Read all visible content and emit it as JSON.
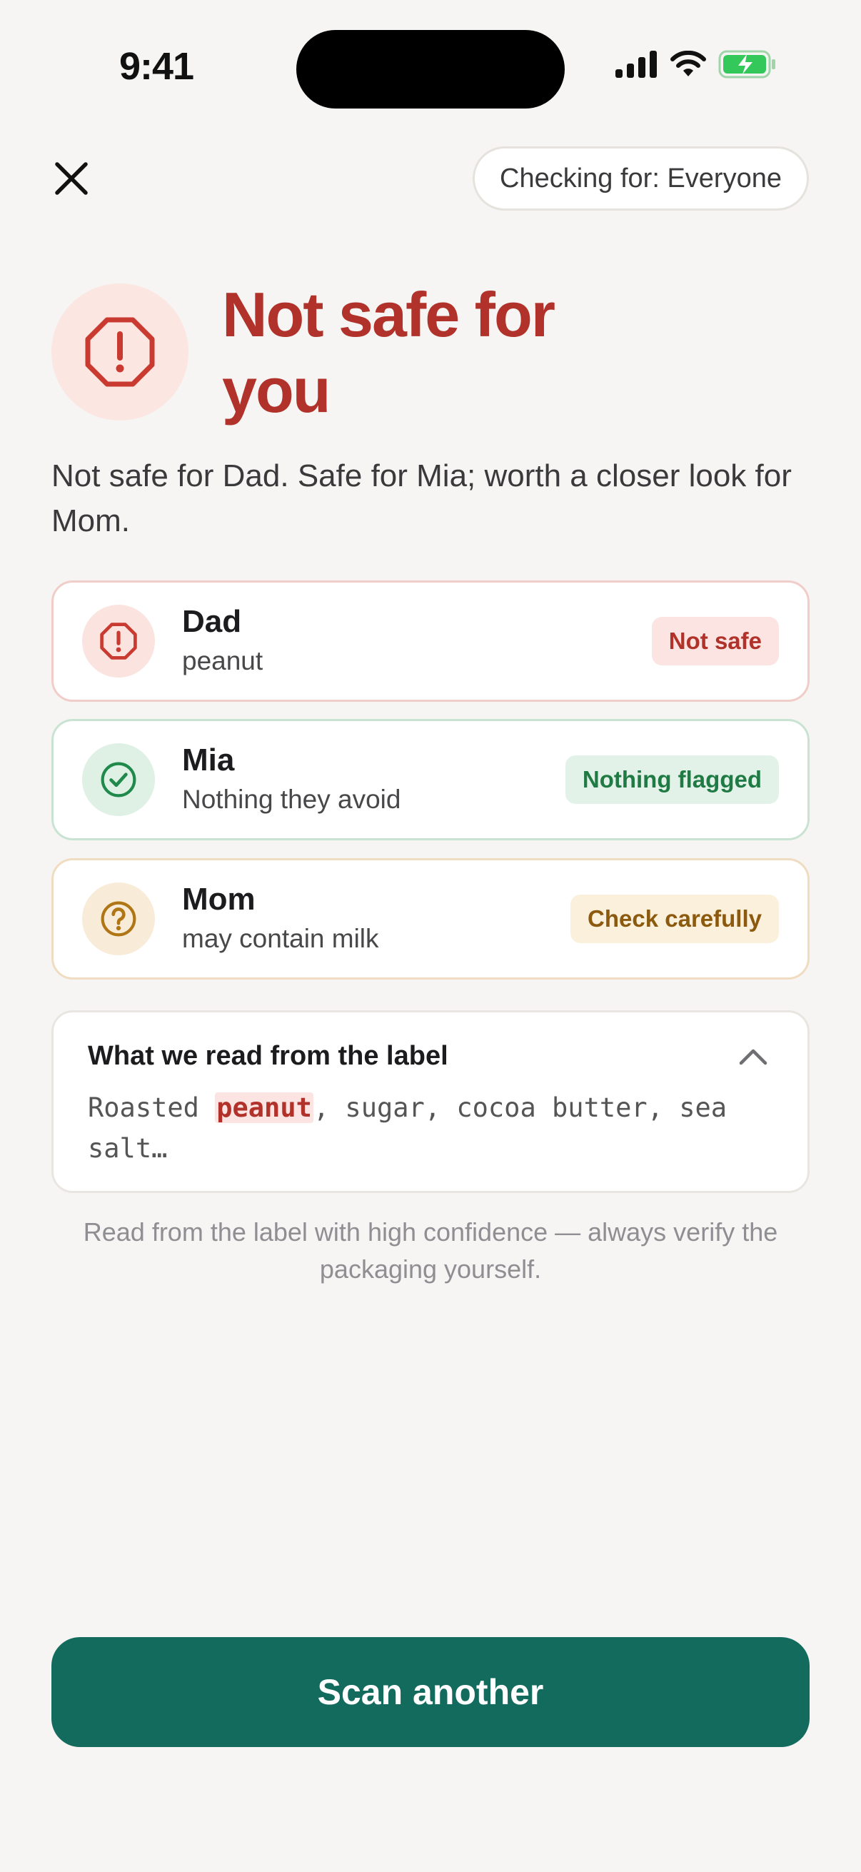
{
  "status_bar": {
    "time": "9:41"
  },
  "header": {
    "close_icon": "close-icon",
    "checking_for": "Checking for: Everyone"
  },
  "hero": {
    "icon": "alert-octagon-icon",
    "title": "Not safe for you",
    "summary": "Not safe for Dad. Safe for Mia; worth a closer look for Mom."
  },
  "members": [
    {
      "name": "Dad",
      "detail": "peanut",
      "status": "Not safe",
      "icon": "alert-octagon-icon"
    },
    {
      "name": "Mia",
      "detail": "Nothing they avoid",
      "status": "Nothing flagged",
      "icon": "check-circle-icon"
    },
    {
      "name": "Mom",
      "detail": "may contain milk",
      "status": "Check carefully",
      "icon": "question-circle-icon"
    }
  ],
  "label_section": {
    "title": "What we read from the label",
    "ingredients_before": "Roasted ",
    "highlighted": "peanut",
    "ingredients_after": ", sugar, cocoa butter, sea salt…"
  },
  "footnote": "Read from the label with high confidence — always verify the packaging yourself.",
  "primary_action": "Scan another",
  "colors": {
    "danger": "#b0322a",
    "safe": "#1f7a44",
    "warn": "#8c5a0e",
    "primary": "#136b5e"
  }
}
